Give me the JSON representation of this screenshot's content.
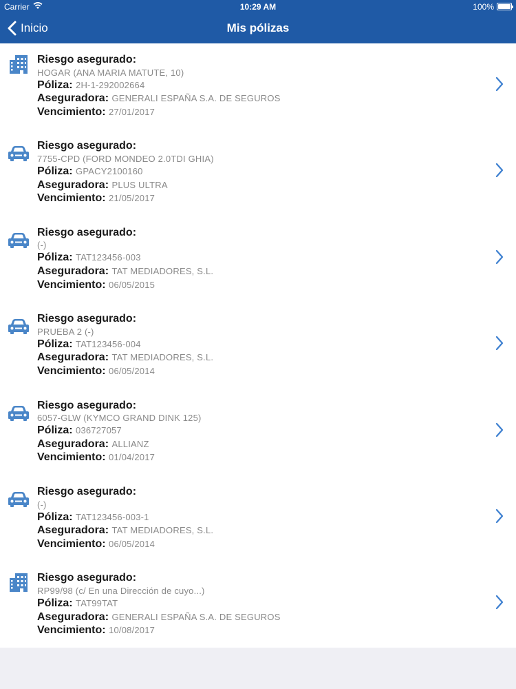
{
  "status_bar": {
    "carrier": "Carrier",
    "time": "10:29 AM",
    "battery": "100%"
  },
  "nav": {
    "back_label": "Inicio",
    "title": "Mis pólizas"
  },
  "labels": {
    "riesgo": "Riesgo asegurado:",
    "poliza": "Póliza:",
    "aseguradora": "Aseguradora:",
    "vencimiento": "Vencimiento:"
  },
  "policies": [
    {
      "icon": "building-icon",
      "riesgo": "HOGAR (ANA MARIA MATUTE, 10)",
      "poliza": "2H-1-292002664",
      "aseguradora": "GENERALI ESPAÑA S.A. DE SEGUROS",
      "vencimiento": "27/01/2017"
    },
    {
      "icon": "car-icon",
      "riesgo": "7755-CPD (FORD MONDEO 2.0TDI GHIA)",
      "poliza": "GPACY2100160",
      "aseguradora": "PLUS ULTRA",
      "vencimiento": "21/05/2017"
    },
    {
      "icon": "car-icon",
      "riesgo": " (-)",
      "poliza": "TAT123456-003",
      "aseguradora": "TAT MEDIADORES, S.L.",
      "vencimiento": "06/05/2015"
    },
    {
      "icon": "car-icon",
      "riesgo": "PRUEBA 2 (-)",
      "poliza": "TAT123456-004",
      "aseguradora": "TAT MEDIADORES, S.L.",
      "vencimiento": "06/05/2014"
    },
    {
      "icon": "car-icon",
      "riesgo": "6057-GLW (KYMCO GRAND DINK 125)",
      "poliza": "036727057",
      "aseguradora": "ALLIANZ",
      "vencimiento": "01/04/2017"
    },
    {
      "icon": "car-icon",
      "riesgo": " (-)",
      "poliza": "TAT123456-003-1",
      "aseguradora": "TAT MEDIADORES, S.L.",
      "vencimiento": "06/05/2014"
    },
    {
      "icon": "building-icon",
      "riesgo": "RP99/98 (c/ En una Dirección de cuyo...)",
      "poliza": "TAT99TAT",
      "aseguradora": "GENERALI ESPAÑA S.A. DE SEGUROS",
      "vencimiento": "10/08/2017"
    }
  ],
  "colors": {
    "header": "#1f5aa6",
    "icon": "#4a86c8",
    "chevron": "#3c7fd0"
  }
}
